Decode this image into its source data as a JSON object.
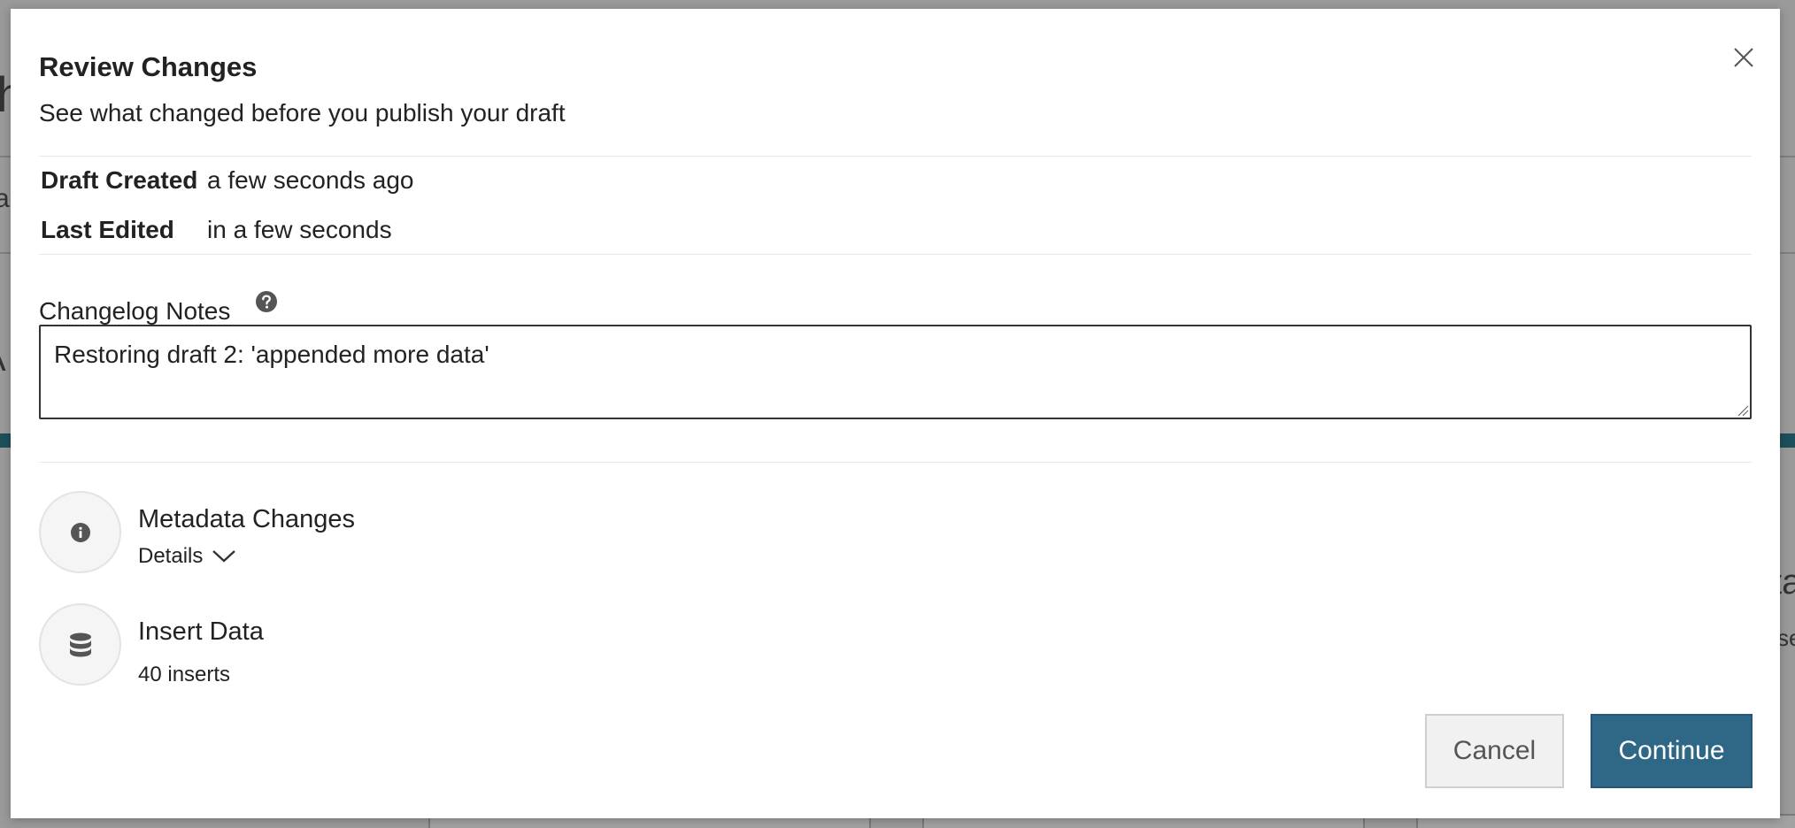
{
  "background": {
    "fragments": [
      "h",
      "a",
      "A",
      "ta",
      "se"
    ]
  },
  "dialog": {
    "title": "Review Changes",
    "subtitle": "See what changed before you publish your draft",
    "meta": {
      "created_label": "Draft Created",
      "created_value": "a few seconds ago",
      "edited_label": "Last Edited",
      "edited_value": "in a few seconds"
    },
    "changelog": {
      "label": "Changelog Notes",
      "value": "Restoring draft 2: 'appended more data'",
      "help_icon": "question-circle-icon"
    },
    "changes": [
      {
        "icon": "info-icon",
        "title": "Metadata Changes",
        "toggle_label": "Details",
        "toggle_icon": "chevron-down-icon"
      },
      {
        "icon": "database-icon",
        "title": "Insert Data",
        "subtitle": "40 inserts"
      }
    ],
    "buttons": {
      "cancel": "Cancel",
      "continue": "Continue"
    },
    "colors": {
      "accent": "#2f6787",
      "backdrop": "#9a9a9a",
      "background_banner": "#1e4f5c"
    }
  }
}
